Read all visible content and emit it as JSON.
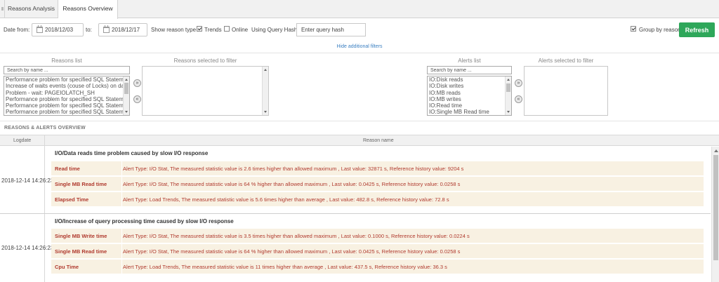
{
  "tabs": [
    {
      "label": "Reasons Analysis",
      "active": false
    },
    {
      "label": "Reasons Overview",
      "active": true
    }
  ],
  "filters": {
    "date_from_label": "Date from:",
    "date_from": "2018/12/03",
    "date_to_label": "to:",
    "date_to": "2018/12/17",
    "show_reason_type_label": "Show reason type",
    "trends_label": "Trends",
    "trends_checked": true,
    "online_label": "Online",
    "online_checked": false,
    "query_hash_label": "Using Query Hash:",
    "query_hash_placeholder": "Enter query hash",
    "group_by_reason_label": "Group by reason",
    "group_by_reason_checked": true,
    "refresh_label": "Refresh",
    "hide_filters_label": "Hide additional filters"
  },
  "reasons_list": {
    "label": "Reasons list",
    "search_placeholder": "Search by name ...",
    "items": [
      "Performance problem for specified SQL Statements",
      "Increase of waits events (couse of Locks) on databo",
      "Problem - wait: PAGEIOLATCH_SH",
      "Performance problem for specified SQL Statements",
      "Performance problem for specified SQL Statements",
      "Performance problem for specified SQL Statements"
    ]
  },
  "reasons_selected": {
    "label": "Reasons selected to filter"
  },
  "alerts_list": {
    "label": "Alerts list",
    "search_placeholder": "Search by name ...",
    "items": [
      "IO:Disk reads",
      "IO:Disk writes",
      "IO:MB reads",
      "IO:MB writes",
      "IO:Read time",
      "IO:Single MB Read time"
    ]
  },
  "alerts_selected": {
    "label": "Alerts selected to filter"
  },
  "overview": {
    "section_title": "REASONS & ALERTS OVERVIEW",
    "col_logdate": "Logdate",
    "col_reason": "Reason name",
    "groups": [
      {
        "logdate": "2018-12-14 14:26:23",
        "title": "I/O/Data reads time problem caused by slow I/O response",
        "alerts": [
          {
            "name": "Read time",
            "desc": "Alert Type: I/O Stat, The measured statistic value is 2.6 times higher than allowed maximum , Last value: 32871 s, Reference history value: 9204 s"
          },
          {
            "name": "Single MB Read time",
            "desc": "Alert Type: I/O Stat, The measured statistic value is 64 % higher than allowed maximum , Last value: 0.0425 s, Reference history value: 0.0258 s"
          },
          {
            "name": "Elapsed Time",
            "desc": "Alert Type: Load Trends, The measured statistic value is 5.6 times higher than average , Last value: 482.8 s, Reference history value: 72.8 s"
          }
        ]
      },
      {
        "logdate": "2018-12-14 14:26:23",
        "title": "I/O/Increase of query processing time caused by slow I/O response",
        "alerts": [
          {
            "name": "Single MB Write time",
            "desc": "Alert Type: I/O Stat, The measured statistic value is 3.5 times higher than allowed maximum , Last value: 0.1000 s, Reference history value: 0.0224 s"
          },
          {
            "name": "Single MB Read time",
            "desc": "Alert Type: I/O Stat, The measured statistic value is 64 % higher than allowed maximum , Last value: 0.0425 s, Reference history value: 0.0258 s"
          },
          {
            "name": "Cpu Time",
            "desc": "Alert Type: Load Trends, The measured statistic value is 11 times higher than average , Last value: 437.5 s, Reference history value: 36.3 s"
          }
        ]
      }
    ]
  },
  "colors": {
    "accent_green": "#2ea75a",
    "alert_text": "#b03a2e",
    "alert_bg": "#f8f1e2",
    "link_blue": "#3a7fc1"
  }
}
